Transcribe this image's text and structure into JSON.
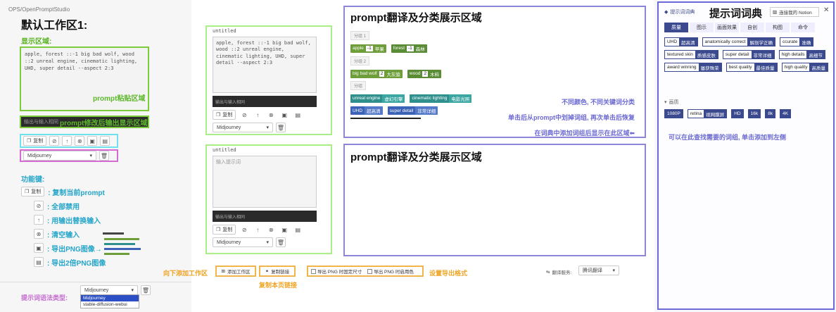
{
  "left": {
    "brand": "OPS/OpenPromptStudio",
    "title": "默认工作区1:",
    "display_label": "显示区域:",
    "prompt_text": "apple, forest ::-1 big bad wolf, wood ::2 unreal engine, cinematic lighting, UHD, super detail --aspect 2:3",
    "paste_note": "prompt粘贴区域",
    "bar_prefix": "输出与输入相同",
    "bar_note": "prompt修改后输出显示区域",
    "copy_label": "复制",
    "select_value": "Midjourney",
    "func_label": "功能键:",
    "functions": [
      {
        "btn": "复制",
        "icon": "copy-icon",
        "glyph": "❐",
        "text": ": 复制当前prompt"
      },
      {
        "btn": "",
        "icon": "disable-icon",
        "glyph": "⊘",
        "text": ": 全部禁用"
      },
      {
        "btn": "",
        "icon": "arrow-up-icon",
        "glyph": "↑",
        "text": ": 用输出替换输入"
      },
      {
        "btn": "",
        "icon": "clear-icon",
        "glyph": "⊗",
        "text": ": 清空输入"
      },
      {
        "btn": "",
        "icon": "image-icon",
        "glyph": "▣",
        "text": ": 导出PNG图像→"
      },
      {
        "btn": "",
        "icon": "image2x-icon",
        "glyph": "▤",
        "text": ": 导出2倍PNG图像"
      }
    ],
    "syntax_label": "提示词语法类型:",
    "syntax_value": "Midjourney",
    "syntax_options": [
      "Midjourney",
      "stable-diffusion-webui"
    ]
  },
  "mid": {
    "ws1": {
      "title": "untitled",
      "prompt": "apple, forest ::-1 big bad wolf, wood ::2 unreal engine, cinematic lighting, UHD, super detail --aspect 2:3",
      "dark_input": "输出与输入相同",
      "copy": "复制",
      "select": "Midjourney"
    },
    "ws2": {
      "title": "untitled",
      "placeholder": "输入提示词",
      "dark_input": "输出与输入相同",
      "copy": "复制",
      "select": "Midjourney"
    }
  },
  "prompt_area": {
    "title1": "prompt翻译及分类展示区域",
    "title2": "prompt翻译及分类展示区域",
    "groups": [
      {
        "label": "分组 1",
        "tags": [
          {
            "en": "apple",
            "w": "-1",
            "zh": "苹果",
            "color": "#6d9e3a"
          },
          {
            "en": "forest",
            "w": "-1",
            "zh": "森林",
            "color": "#5a8b35"
          }
        ]
      },
      {
        "label": "分组 2",
        "tags": [
          {
            "en": "big bad wolf",
            "w": "2",
            "zh": "大灰狼",
            "color": "#6d9e3a"
          },
          {
            "en": "wood",
            "w": "2",
            "zh": "木料",
            "color": "#5a8b35"
          }
        ]
      },
      {
        "label": "分组",
        "tags": [
          {
            "en": "unreal engine",
            "w": "",
            "zh": "虚幻引擎",
            "color": "#2f8f8c"
          },
          {
            "en": "cinematic lighting",
            "w": "",
            "zh": "电影光照",
            "color": "#2f8f8c"
          }
        ]
      },
      {
        "label": "",
        "tags": [
          {
            "en": "UHD",
            "w": "",
            "zh": "超高清",
            "color": "#3d63b8"
          },
          {
            "en": "super detail",
            "w": "",
            "zh": "非常详细",
            "color": "#3d63b8"
          }
        ]
      }
    ],
    "note1": "不同颜色, 不同关键词分类",
    "note2": "单击后从prompt中划掉词组, 再次单击后恢复",
    "note3": "在词典中添加词组后显示在此区域⬅"
  },
  "dict": {
    "brand": "提示词词典",
    "title": "提示词词典",
    "notion": "连接我的 Notion",
    "tabs": [
      "质量",
      "图示",
      "画面效果",
      "自创",
      "构图",
      "命令"
    ],
    "words": [
      {
        "en": "UHD",
        "zh": "超高清"
      },
      {
        "en": "anatomically correct",
        "zh": "解剖学正确"
      },
      {
        "en": "ccurate",
        "zh": "准确"
      },
      {
        "en": "textured skin",
        "zh": "质感皮肤"
      },
      {
        "en": "super detail",
        "zh": "非常详细"
      },
      {
        "en": "high details",
        "zh": "高细节"
      },
      {
        "en": "award winning",
        "zh": "屡获殊荣"
      },
      {
        "en": "best quality",
        "zh": "最佳质量"
      },
      {
        "en": "high quality",
        "zh": "高质量"
      }
    ],
    "section2": "画质",
    "res": [
      "1080P",
      "retina",
      "视网膜屏",
      "HD",
      "16k",
      "8k",
      "4K"
    ],
    "hint": "可以在此查找需要的词组, 单击添加到左侧"
  },
  "bottom": {
    "add_note": "向下添加工作区",
    "add_btn": "添加工作区",
    "copy_link_btn": "复制链接",
    "copy_link_note": "复制本页链接",
    "export1": "导出 PNG 时固定尺寸",
    "export2": "导出 PNG 时启用色",
    "export_note": "设置导出格式",
    "translate_label": "翻译服务:",
    "translate_value": "腾讯翻译"
  }
}
